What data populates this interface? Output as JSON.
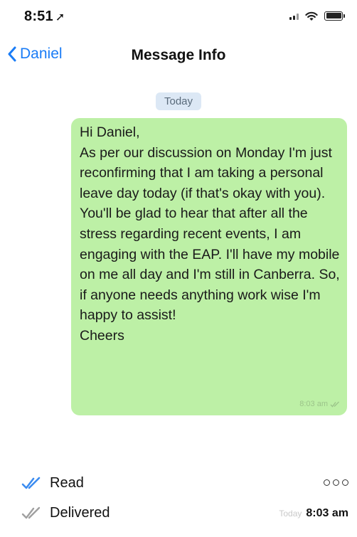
{
  "status_bar": {
    "time": "8:51",
    "location_glyph": "➚",
    "icons": [
      "signal-icon",
      "wifi-icon",
      "battery-icon"
    ]
  },
  "nav": {
    "back_label": "Daniel",
    "title": "Message Info"
  },
  "date_pill": "Today",
  "message": {
    "text": "Hi Daniel,\nAs per our discussion on Monday I'm just reconfirming that I am taking a personal leave day today (if that's okay with you). You'll be glad to hear that after all the stress regarding recent events, I am engaging with the EAP. I'll have my mobile on me all day and I'm still in Canberra. So, if anyone needs anything work wise I'm happy to assist!\nCheers",
    "time": "8:03 am"
  },
  "receipts": {
    "read_label": "Read",
    "delivered_label": "Delivered",
    "delivered_day": "Today",
    "delivered_time": "8:03 am"
  },
  "colors": {
    "accent": "#1a7cf6",
    "bubble": "#bdf0a6",
    "pill": "#dce8f5",
    "read_check": "#3b8cf0",
    "delivered_check": "#a0a0a0"
  }
}
